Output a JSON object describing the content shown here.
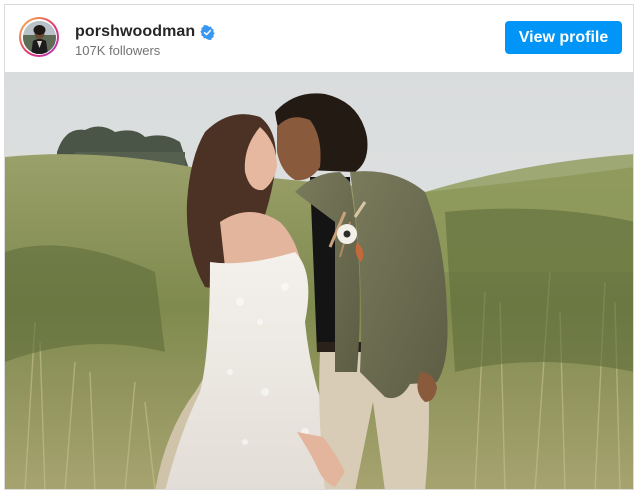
{
  "post": {
    "username": "porshwoodman",
    "followers": "107K followers",
    "view_profile_label": "View profile",
    "verified_icon": "verified-badge-icon"
  },
  "colors": {
    "brand_blue": "#0095f6",
    "verified_blue": "#3897f0",
    "text_primary": "#262626",
    "text_secondary": "#737373"
  }
}
